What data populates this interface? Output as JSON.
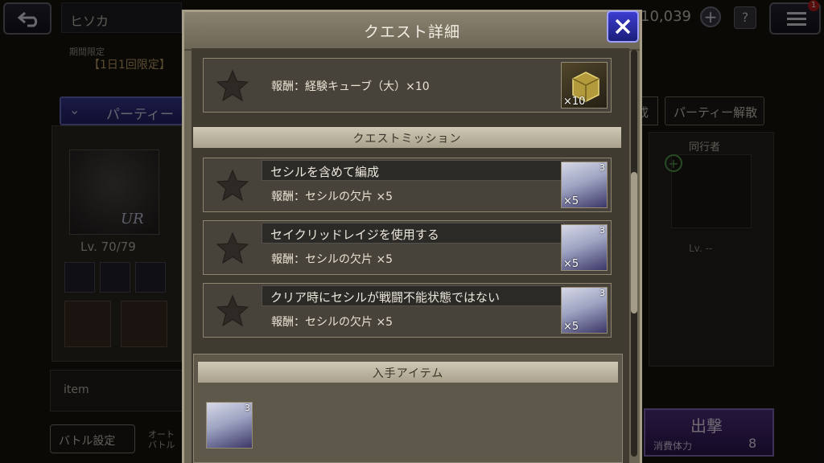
{
  "topbar": {
    "player_name": "ヒソカ",
    "gem_count": "10,039",
    "plus_label": "+",
    "help_label": "?",
    "notification_count": "1"
  },
  "event": {
    "limited_label": "期間限定",
    "limited_text": "【1日1回限定】"
  },
  "party": {
    "title": "パーティー",
    "level": "Lv. 70/79",
    "rarity": "UR",
    "form_button": "成",
    "dissolve_button": "パーティー解散",
    "companion_label": "同行者",
    "companion_level": "Lv. --",
    "item_label": "item"
  },
  "bottom": {
    "battle_settings": "バトル設定",
    "auto_battle": "オート\nバトル",
    "sortie_label": "出撃",
    "stamina_label": "消費体力",
    "stamina_value": "8"
  },
  "modal": {
    "title": "クエスト詳細",
    "quest_reward": {
      "text": "報酬：経験キューブ（大）×10",
      "qty": "×10"
    },
    "missions_header": "クエストミッション",
    "missions": [
      {
        "title": "セシルを含めて編成",
        "reward": "報酬：セシルの欠片 ×5",
        "qty": "×5",
        "corner": "3"
      },
      {
        "title": "セイクリッドレイジを使用する",
        "reward": "報酬：セシルの欠片 ×5",
        "qty": "×5",
        "corner": "3"
      },
      {
        "title": "クリア時にセシルが戦闘不能状態ではない",
        "reward": "報酬：セシルの欠片 ×5",
        "qty": "×5",
        "corner": "3"
      }
    ],
    "items_header": "入手アイテム",
    "obtained_item_corner": "3"
  },
  "colors": {
    "close_button": "#2a2ca8",
    "sortie_button": "#4a2a7c",
    "party_bar": "#2f2f88"
  },
  "icons": [
    "back-arrow-icon",
    "menu-icon",
    "close-icon",
    "star-icon",
    "exp-cube-icon",
    "cecil-shard-icon"
  ]
}
